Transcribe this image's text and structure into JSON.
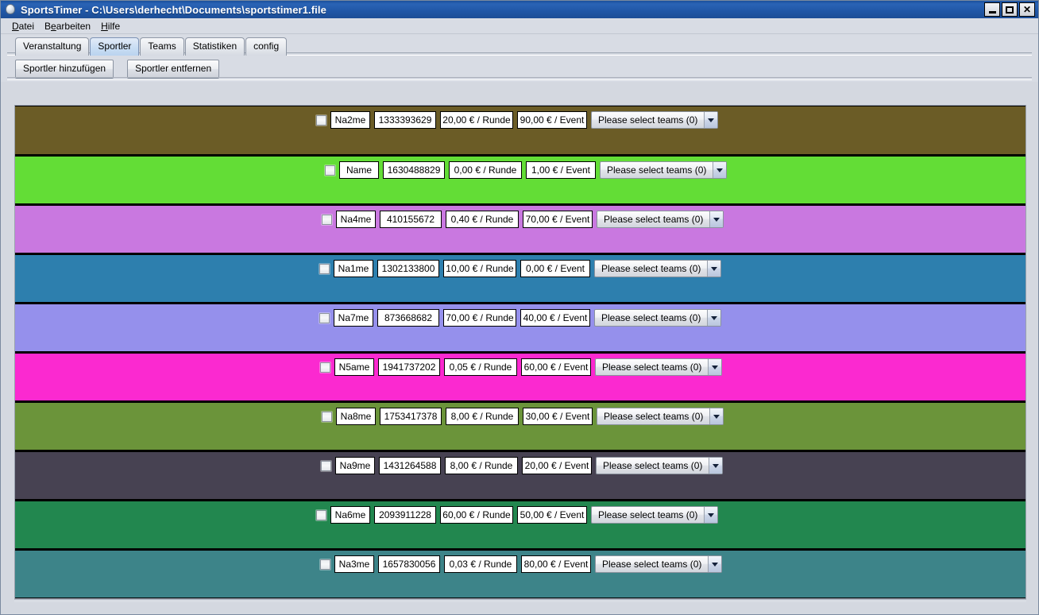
{
  "window": {
    "title": "SportsTimer - C:\\Users\\derhecht\\Documents\\sportstimer1.file",
    "icon": "app-ball-icon",
    "controls": {
      "minimize": "minimize-icon",
      "maximize": "maximize-icon",
      "close": "close-icon"
    }
  },
  "menubar": {
    "items": [
      {
        "label": "Datei"
      },
      {
        "label": "Bearbeiten"
      },
      {
        "label": "Hilfe"
      }
    ]
  },
  "tabs": {
    "selected": "Sportler",
    "items": [
      {
        "label": "Veranstaltung"
      },
      {
        "label": "Sportler"
      },
      {
        "label": "Teams"
      },
      {
        "label": "Statistiken"
      },
      {
        "label": "config"
      }
    ]
  },
  "toolbar": {
    "add_label": "Sportler hinzufügen",
    "remove_label": "Sportler entfernen"
  },
  "athletes": {
    "combo_placeholder": "Please select teams (0)",
    "rows": [
      {
        "color": "#6b5c26",
        "checked": false,
        "name": "Na2me",
        "id": "1333393629",
        "rate": "20,00 € / Runde",
        "event": "90,00 € / Event",
        "teams": "Please select teams (0)",
        "indent": 379
      },
      {
        "color": "#63dd36",
        "checked": false,
        "name": "Name",
        "id": "1630488829",
        "rate": "0,00 € / Runde",
        "event": "1,00 € / Event",
        "teams": "Please select teams (0)",
        "indent": 390
      },
      {
        "color": "#c978e0",
        "checked": false,
        "name": "Na4me",
        "id": "410155672",
        "rate": "0,40 € / Runde",
        "event": "70,00 € / Event",
        "teams": "Please select teams (0)",
        "indent": 386
      },
      {
        "color": "#2d7fae",
        "checked": false,
        "name": "Na1me",
        "id": "1302133800",
        "rate": "10,00 € / Runde",
        "event": "0,00 € / Event",
        "teams": "Please select teams (0)",
        "indent": 383
      },
      {
        "color": "#9590ec",
        "checked": false,
        "name": "Na7me",
        "id": "873668682",
        "rate": "70,00 € / Runde",
        "event": "40,00 € / Event",
        "teams": "Please select teams (0)",
        "indent": 383
      },
      {
        "color": "#fb29d0",
        "checked": false,
        "name": "N5ame",
        "id": "1941737202",
        "rate": "0,05 € / Runde",
        "event": "60,00 € / Event",
        "teams": "Please select teams (0)",
        "indent": 384
      },
      {
        "color": "#6b943a",
        "checked": false,
        "name": "Na8me",
        "id": "1753417378",
        "rate": "8,00 € / Runde",
        "event": "30,00 € / Event",
        "teams": "Please select teams (0)",
        "indent": 386
      },
      {
        "color": "#474252",
        "checked": false,
        "name": "Na9me",
        "id": "1431264588",
        "rate": "8,00 € / Runde",
        "event": "20,00 € / Event",
        "teams": "Please select teams (0)",
        "indent": 385
      },
      {
        "color": "#22874f",
        "checked": false,
        "name": "Na6me",
        "id": "2093911228",
        "rate": "60,00 € / Runde",
        "event": "50,00 € / Event",
        "teams": "Please select teams (0)",
        "indent": 379
      },
      {
        "color": "#3d8489",
        "checked": false,
        "name": "Na3me",
        "id": "1657830056",
        "rate": "0,03 € / Runde",
        "event": "80,00 € / Event",
        "teams": "Please select teams (0)",
        "indent": 384
      }
    ]
  }
}
